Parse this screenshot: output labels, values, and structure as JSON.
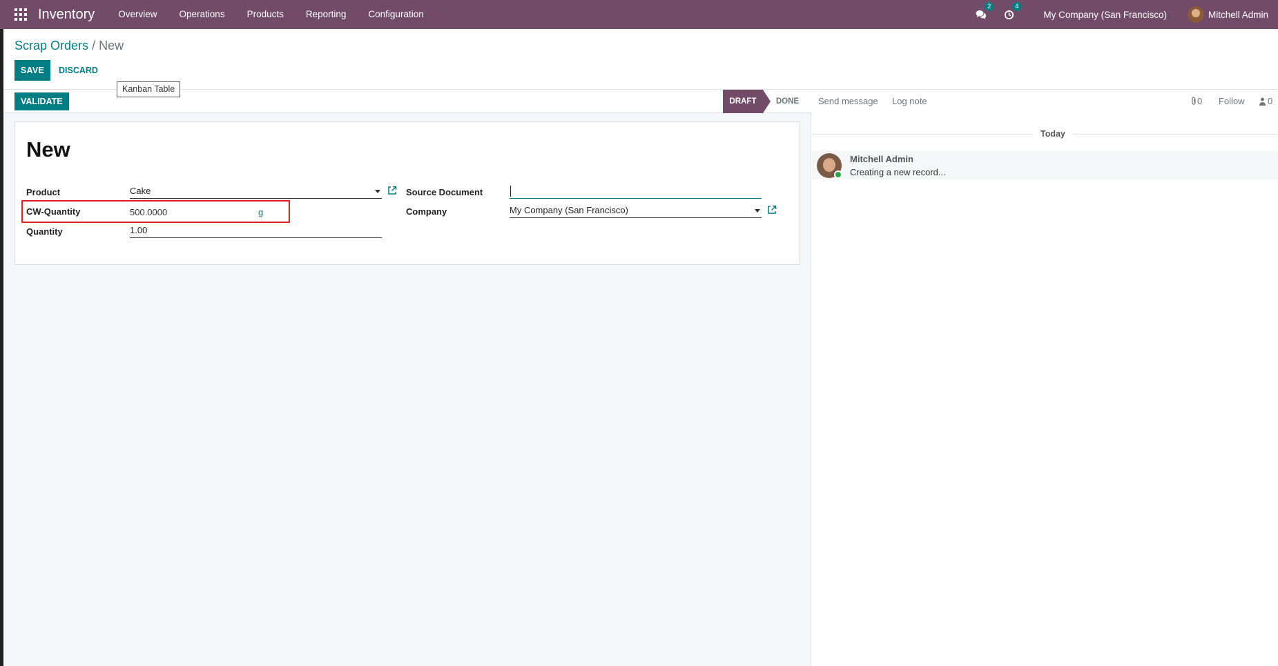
{
  "navbar": {
    "brand": "Inventory",
    "menu": [
      "Overview",
      "Operations",
      "Products",
      "Reporting",
      "Configuration"
    ],
    "messages_count": "2",
    "activities_count": "4",
    "company": "My Company (San Francisco)",
    "user": "Mitchell Admin",
    "color": "#714B67"
  },
  "breadcrumb": {
    "parent": "Scrap Orders",
    "separator": "/",
    "current": "New"
  },
  "actions": {
    "save": "SAVE",
    "discard": "DISCARD"
  },
  "tooltip": "Kanban Table",
  "statusbar": {
    "validate": "VALIDATE",
    "stages": [
      "DRAFT",
      "DONE"
    ],
    "active_stage": "DRAFT"
  },
  "form": {
    "title": "New",
    "product_label": "Product",
    "product_value": "Cake",
    "cw_quantity_label": "CW-Quantity",
    "cw_quantity_value": "500.0000",
    "cw_quantity_uom": "g",
    "quantity_label": "Quantity",
    "quantity_value": "1.00",
    "source_document_label": "Source Document",
    "source_document_value": "",
    "company_label": "Company",
    "company_value": "My Company (San Francisco)"
  },
  "chatter": {
    "send_message": "Send message",
    "log_note": "Log note",
    "attachments_count": "0",
    "follow": "Follow",
    "followers_count": "0",
    "date_separator": "Today",
    "messages": [
      {
        "author": "Mitchell Admin",
        "body": "Creating a new record..."
      }
    ]
  },
  "colors": {
    "primary": "#017e84",
    "brand": "#714B67",
    "highlight_border": "#e02020"
  }
}
